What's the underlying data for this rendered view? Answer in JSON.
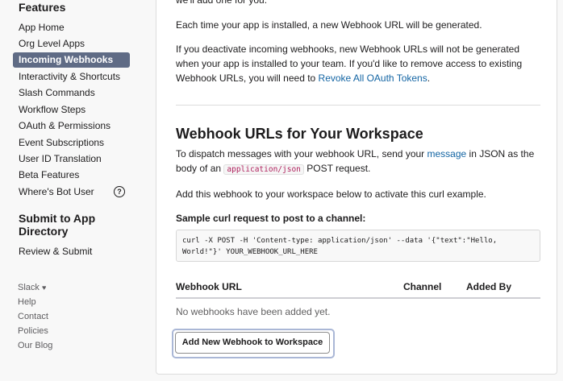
{
  "sidebar": {
    "features_title": "Features",
    "items": [
      {
        "label": "App Home"
      },
      {
        "label": "Org Level Apps"
      },
      {
        "label": "Incoming Webhooks",
        "active": true
      },
      {
        "label": "Interactivity & Shortcuts"
      },
      {
        "label": "Slash Commands"
      },
      {
        "label": "Workflow Steps"
      },
      {
        "label": "OAuth & Permissions"
      },
      {
        "label": "Event Subscriptions"
      },
      {
        "label": "User ID Translation"
      },
      {
        "label": "Beta Features"
      },
      {
        "label": "Where's Bot User",
        "help_icon": "?"
      }
    ],
    "submit_title_line1": "Submit to App",
    "submit_title_line2": "Directory",
    "review_submit": "Review & Submit",
    "footer": {
      "slack": "Slack",
      "heart": "♥",
      "help": "Help",
      "contact": "Contact",
      "policies": "Policies",
      "our_blog": "Our Blog"
    }
  },
  "main": {
    "top_fragment": "we'll add one for you.",
    "para_generated": "Each time your app is installed, a new Webhook URL will be generated.",
    "para_deactivate": "If you deactivate incoming webhooks, new Webhook URLs will not be generated when your app is installed to your team. If you'd like to remove access to existing Webhook URLs, you will need to ",
    "revoke_link": "Revoke All OAuth Tokens",
    "revoke_suffix": ".",
    "section_title": "Webhook URLs for Your Workspace",
    "dispatch_prefix": "To dispatch messages with your webhook URL, send your ",
    "message_link": "message",
    "dispatch_mid": " in JSON as the body of an ",
    "content_type": "application/json",
    "dispatch_suffix": " POST request.",
    "add_webhook_text": "Add this webhook to your workspace below to activate this curl example.",
    "sample_label": "Sample curl request to post to a channel:",
    "curl_code": "curl -X POST -H 'Content-type: application/json' --data '{\"text\":\"Hello, World!\"}' YOUR_WEBHOOK_URL_HERE",
    "table": {
      "col_url": "Webhook URL",
      "col_channel": "Channel",
      "col_added_by": "Added By",
      "empty": "No webhooks have been added yet."
    },
    "add_button": "Add New Webhook to Workspace"
  },
  "colors": {
    "active_nav_bg": "#5f6b85",
    "link": "#1264a3",
    "focus_ring": "#aab7d6"
  }
}
